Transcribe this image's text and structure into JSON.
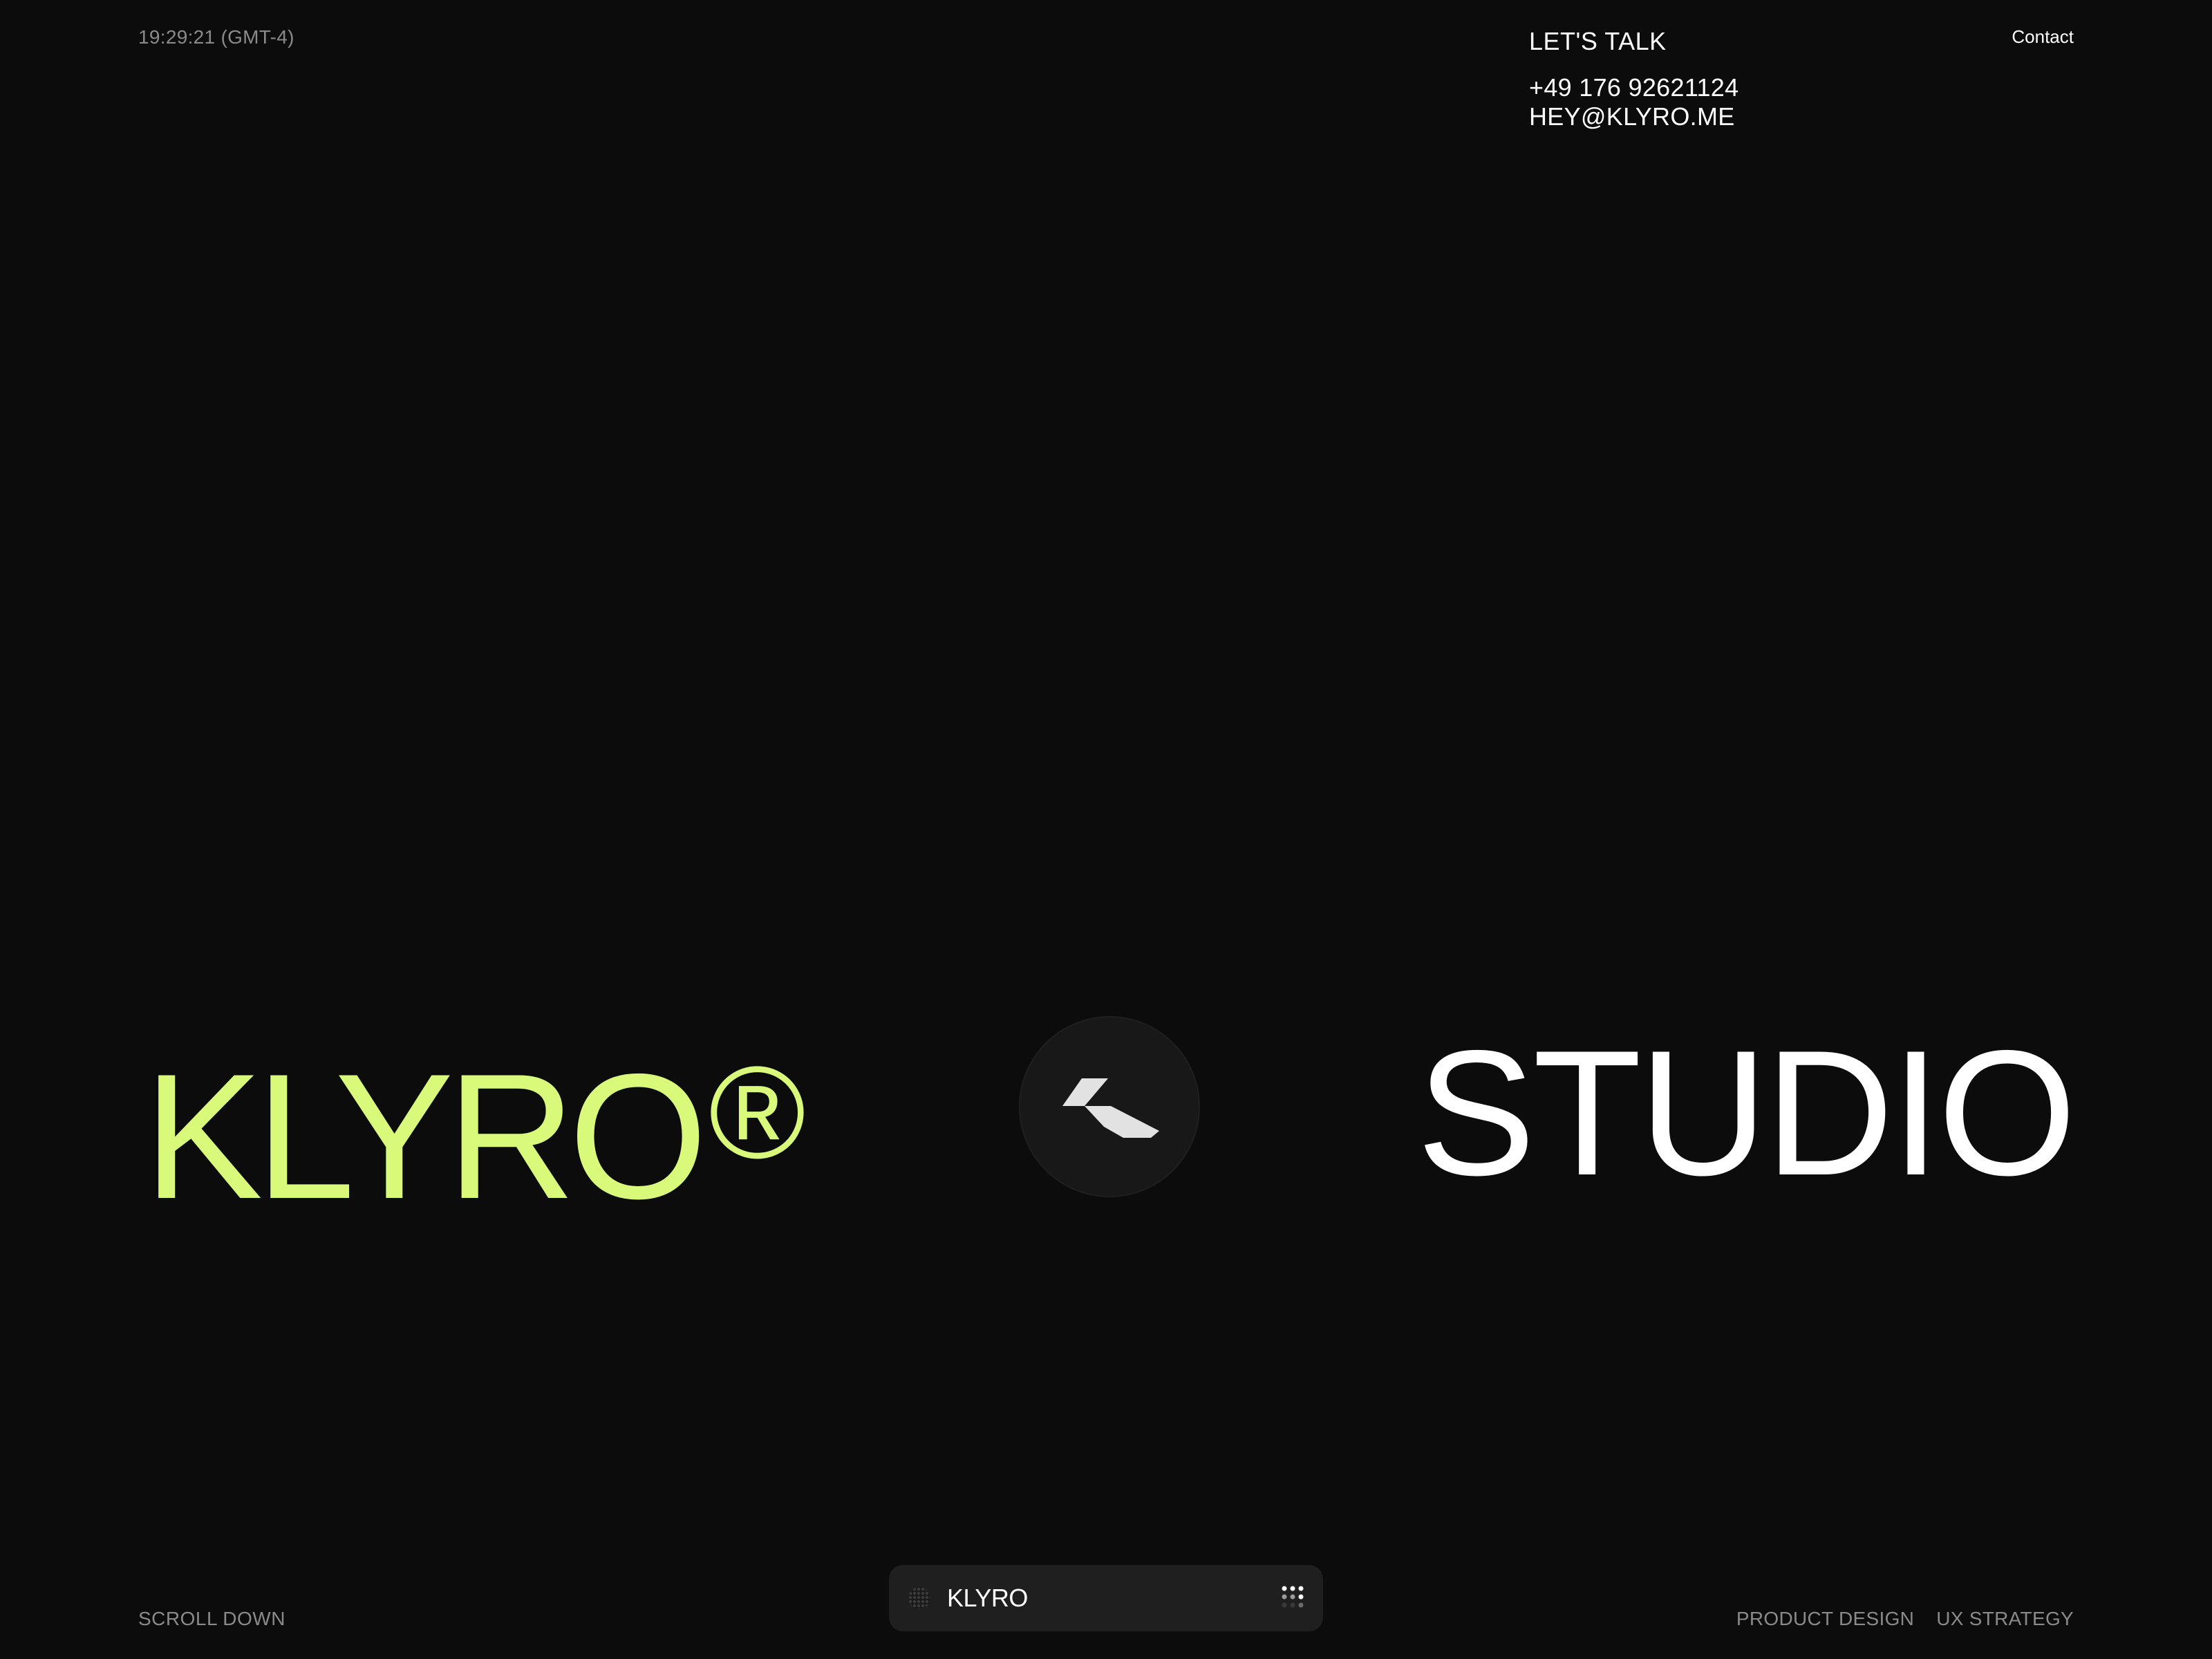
{
  "header": {
    "clock": "19:29:21 (GMT-4)",
    "contact_link": "Contact"
  },
  "lets_talk": {
    "heading": "LET'S TALK",
    "phone": "+49 176 92621124",
    "email": "HEY@KLYRO.ME"
  },
  "hero": {
    "brand": "KLYRO",
    "brand_mark": "®",
    "word": "STUDIO",
    "center_icon": "klyro-logo-icon"
  },
  "footer": {
    "scroll_hint": "SCROLL DOWN",
    "dock_label": "KLYRO",
    "dock_icon": "dotted-circle-icon",
    "dock_menu_icon": "grid-dots-menu-icon",
    "services": [
      "PRODUCT DESIGN",
      "UX STRATEGY"
    ]
  },
  "colors": {
    "background": "#0c0c0c",
    "accent": "#d8f97a",
    "muted_text": "#8a8a8a",
    "primary_text": "#ffffff",
    "dock_background": "#1f1f1f"
  }
}
